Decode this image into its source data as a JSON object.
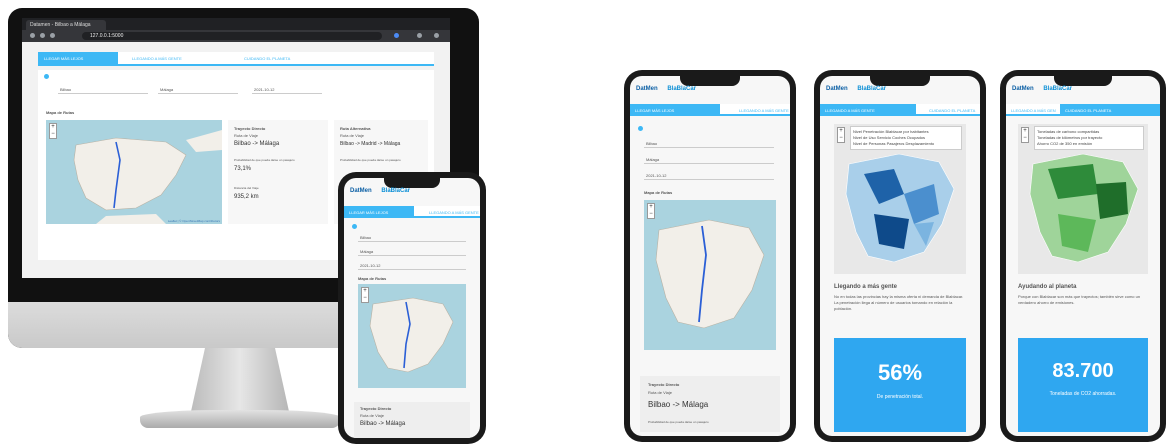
{
  "browser": {
    "tab_title": "Datamen - Bilbao a Málaga",
    "url": "127.0.0.1:5000"
  },
  "app": {
    "logo_primary": "DatMen",
    "logo_secondary": "BlaBlaCar",
    "tabs": [
      "LLEGAR MÁS LEJOS",
      "LLEGANDO A MÁS GENTE",
      "CUIDANDO EL PLANETA"
    ]
  },
  "form": {
    "origin": "Bilbao",
    "destination": "Málaga",
    "date": "2021-10-12"
  },
  "route_section": {
    "title": "Mapa de Rutas",
    "direct_title": "Trayecto Directo",
    "direct_sub": "Ruta de Viaje",
    "direct_route": "Bilbao -> Málaga",
    "alt_title": "Ruta Alternativa",
    "alt_sub": "Ruta de Viaje",
    "alt_route": "Bilbao -> Madrid -> Málaga",
    "prob_label": "Probabilidad de que pueda darse un pasajero",
    "prob_value": "73,1%",
    "dist_label": "Distancia del Viaje",
    "dist_value": "935,2 km",
    "map_attr": "Leaflet | © OpenStreetMap contributors"
  },
  "phone2": {
    "legend": [
      "Nivel Penetración Blablacar por habitantes",
      "Nivel de Uso Servicio Coches Ocupados",
      "Nivel de Personas Pasajeros Desplazamiento"
    ],
    "heading": "Llegando a más gente",
    "body": "No en todas las provincias hay la misma oferta ni demanda de Blablacar. La penetración llega al número de usuarios tomando en relación la población.",
    "stat_value": "56%",
    "stat_label": "De penetración total."
  },
  "phone3": {
    "legend": [
      "Toneladas de carbono compartidas",
      "Toneladas de kilómetros por trayecto",
      "Ahorro CO2 de 350 en emisión"
    ],
    "heading": "Ayudando al planeta",
    "body": "Porque con Blablacar son más que trayectos; también sirve como un verdadero ahorro de emisiones.",
    "stat_value": "83.700",
    "stat_label": "Toneladas de CO2 ahorradas."
  },
  "colors": {
    "accent": "#3db8f5",
    "brand_blue": "#0b5fa5",
    "map_water": "#aad3df",
    "route": "#2b5fd6"
  }
}
